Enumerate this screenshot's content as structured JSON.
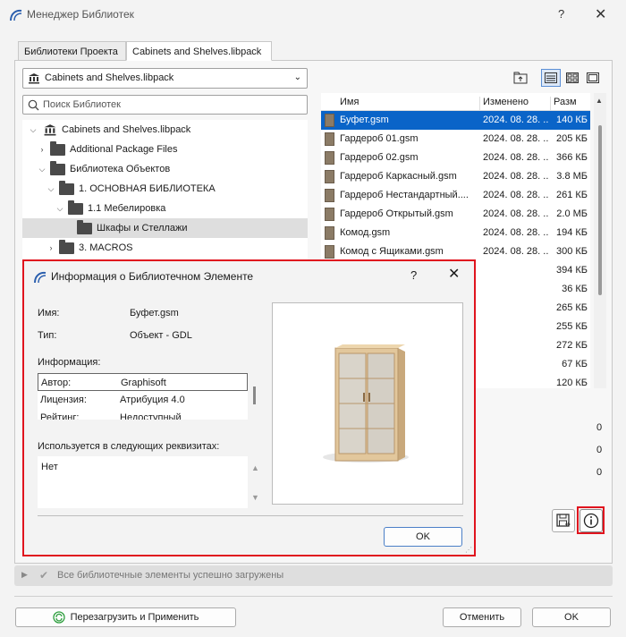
{
  "window": {
    "title": "Менеджер Библиотек",
    "help": "?",
    "close": "✕"
  },
  "tabs": [
    {
      "label": "Библиотеки Проекта",
      "active": false
    },
    {
      "label": "Cabinets and Shelves.libpack",
      "active": true
    }
  ],
  "library_select": {
    "value": "Cabinets and Shelves.libpack"
  },
  "search": {
    "placeholder": "Поиск Библиотек"
  },
  "tree": [
    {
      "label": "Cabinets and Shelves.libpack",
      "type": "library",
      "state": "expanded"
    },
    {
      "label": "Additional Package Files",
      "type": "folder",
      "state": "collapsed"
    },
    {
      "label": "Библиотека Объектов",
      "type": "folder",
      "state": "expanded"
    },
    {
      "label": "1. ОСНОВНАЯ БИБЛИОТЕКА",
      "type": "folder",
      "state": "expanded"
    },
    {
      "label": "1.1 Мебелировка",
      "type": "folder",
      "state": "expanded"
    },
    {
      "label": "Шкафы и Стеллажи",
      "type": "folder",
      "state": "leaf",
      "selected": true
    },
    {
      "label": "3. MACROS",
      "type": "folder",
      "state": "collapsed"
    }
  ],
  "files": {
    "headers": {
      "name": "Имя",
      "modified": "Изменено",
      "size": "Разм"
    },
    "rows": [
      {
        "name": "Буфет.gsm",
        "modified": "2024. 08. 28. ...",
        "size": "140 КБ",
        "selected": true
      },
      {
        "name": "Гардероб 01.gsm",
        "modified": "2024. 08. 28. ...",
        "size": "205 КБ"
      },
      {
        "name": "Гардероб 02.gsm",
        "modified": "2024. 08. 28. ...",
        "size": "366 КБ"
      },
      {
        "name": "Гардероб Каркасный.gsm",
        "modified": "2024. 08. 28. ...",
        "size": "3.8 МБ"
      },
      {
        "name": "Гардероб Нестандартный....",
        "modified": "2024. 08. 28. ...",
        "size": "261 КБ"
      },
      {
        "name": "Гардероб Открытый.gsm",
        "modified": "2024. 08. 28. ...",
        "size": "2.0 МБ"
      },
      {
        "name": "Комод.gsm",
        "modified": "2024. 08. 28. ...",
        "size": "194 КБ"
      },
      {
        "name": "Комод с Ящиками.gsm",
        "modified": "2024. 08. 28. ...",
        "size": "300 КБ"
      },
      {
        "name": "",
        "modified": "",
        "size": "394 КБ"
      },
      {
        "name": "",
        "modified": "",
        "size": "36 КБ"
      },
      {
        "name": "",
        "modified": "",
        "size": "265 КБ"
      },
      {
        "name": "",
        "modified": "",
        "size": "255 КБ"
      },
      {
        "name": "",
        "modified": "",
        "size": "272 КБ"
      },
      {
        "name": "",
        "modified": "",
        "size": "67 КБ"
      },
      {
        "name": "",
        "modified": "",
        "size": "120 КБ"
      }
    ]
  },
  "counts": [
    "0",
    "0",
    "0"
  ],
  "status": {
    "text": "Все библиотечные элементы успешно загружены"
  },
  "footer": {
    "reload": "Перезагрузить и Применить",
    "cancel": "Отменить",
    "ok": "OK"
  },
  "info_dialog": {
    "title": "Информация о Библиотечном Элементе",
    "help": "?",
    "close": "✕",
    "name_label": "Имя:",
    "name_value": "Буфет.gsm",
    "type_label": "Тип:",
    "type_value": "Объект - GDL",
    "info_label": "Информация:",
    "props": [
      {
        "key": "Автор:",
        "value": "Graphisoft"
      },
      {
        "key": "Лицензия:",
        "value": "Атрибуция 4.0"
      },
      {
        "key": "Рейтинг:",
        "value": "Недоступный"
      }
    ],
    "used_label": "Используется в следующих реквизитах:",
    "used_value": "Нет",
    "ok": "OK"
  },
  "colors": {
    "selection": "#0a64c8",
    "highlight_border": "#e0141e"
  }
}
